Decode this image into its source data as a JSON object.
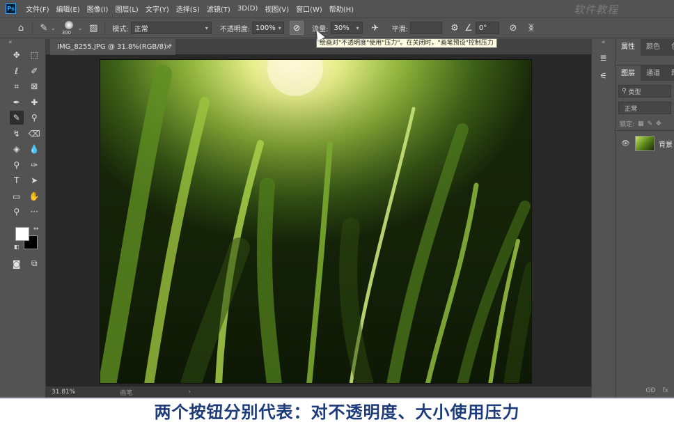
{
  "app": {
    "logo_text": "Ps",
    "watermark": "软件教程"
  },
  "menu": [
    "文件(F)",
    "编辑(E)",
    "图像(I)",
    "图层(L)",
    "文字(Y)",
    "选择(S)",
    "滤镜(T)",
    "3D(D)",
    "视图(V)",
    "窗口(W)",
    "帮助(H)"
  ],
  "options": {
    "brush_size": "300",
    "mode_label": "模式:",
    "mode_value": "正常",
    "opacity_label": "不透明度:",
    "opacity_value": "100%",
    "flow_label": "流量:",
    "flow_value": "30%",
    "smoothing_label": "平滑:",
    "smoothing_value": "",
    "angle_value": "0°"
  },
  "tooltip": "绘画对\"不透明度\"使用\"压力\"。在关闭时，\"画笔预设\"控制压力",
  "document": {
    "tab_title": "IMG_8255.JPG @ 31.8%(RGB/8) *",
    "tab_close": "×",
    "zoom": "31.81%",
    "status_info": "画笔",
    "status_arrow": "›"
  },
  "panels": {
    "properties_tab": "属性",
    "color_tab": "颜色",
    "swatches_tab": "色",
    "layers_tab": "图层",
    "channels_tab": "通道",
    "paths_tab": "路",
    "filter_placeholder": "类型",
    "blend_mode": "正常",
    "lock_label": "锁定:",
    "layer_name": "背景",
    "footer_link": "GĐ",
    "footer_fx": "fx"
  },
  "caption": "两个按钮分别代表：对不透明度、大小使用压力",
  "colors": {
    "foreground": "#ffffff",
    "background": "#000000",
    "caption_text": "#1d3a7a"
  }
}
